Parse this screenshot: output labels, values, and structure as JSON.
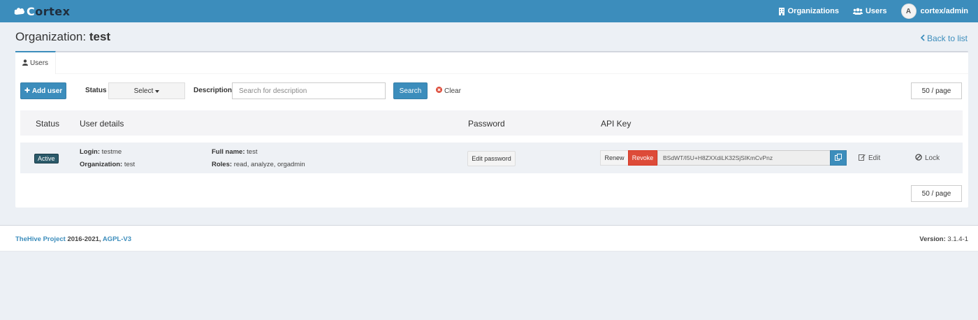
{
  "navbar": {
    "brand_left": "C",
    "brand_right": "rtex",
    "brand_mid": "o",
    "organizations": "Organizations",
    "users": "Users",
    "avatar_initial": "A",
    "user": "cortex/admin",
    "color": "#3c8dbc"
  },
  "header": {
    "title_prefix": "Organization: ",
    "title_name": "test",
    "back_link": "Back to list"
  },
  "tabs": [
    {
      "label": "Users",
      "icon": "user-icon"
    }
  ],
  "toolbar": {
    "add_user": "Add user",
    "status_label": "Status",
    "status_select": "Select",
    "description_label": "Description",
    "description_placeholder": "Search for description",
    "search": "Search",
    "clear": "Clear",
    "per_page": "50 / page"
  },
  "table": {
    "columns": [
      "Status",
      "User details",
      "Password",
      "API Key"
    ],
    "rows": [
      {
        "status": "Active",
        "login_label": "Login:",
        "login": "testme",
        "org_label": "Organization:",
        "org": "test",
        "fullname_label": "Full name:",
        "fullname": "test",
        "roles_label": "Roles:",
        "roles": "read, analyze, orgadmin",
        "edit_password": "Edit password",
        "renew": "Renew",
        "revoke": "Revoke",
        "api_key": "BSdWT/I5U+H8ZXXdiLK32SjSIKmCvPnz",
        "edit": "Edit",
        "lock": "Lock"
      }
    ]
  },
  "pagination": {
    "per_page": "50 / page"
  },
  "footer": {
    "project": "TheHive Project",
    "years": " 2016-2021, ",
    "license": "AGPL-V3",
    "version_label": "Version:",
    "version": "3.1.4-1"
  }
}
